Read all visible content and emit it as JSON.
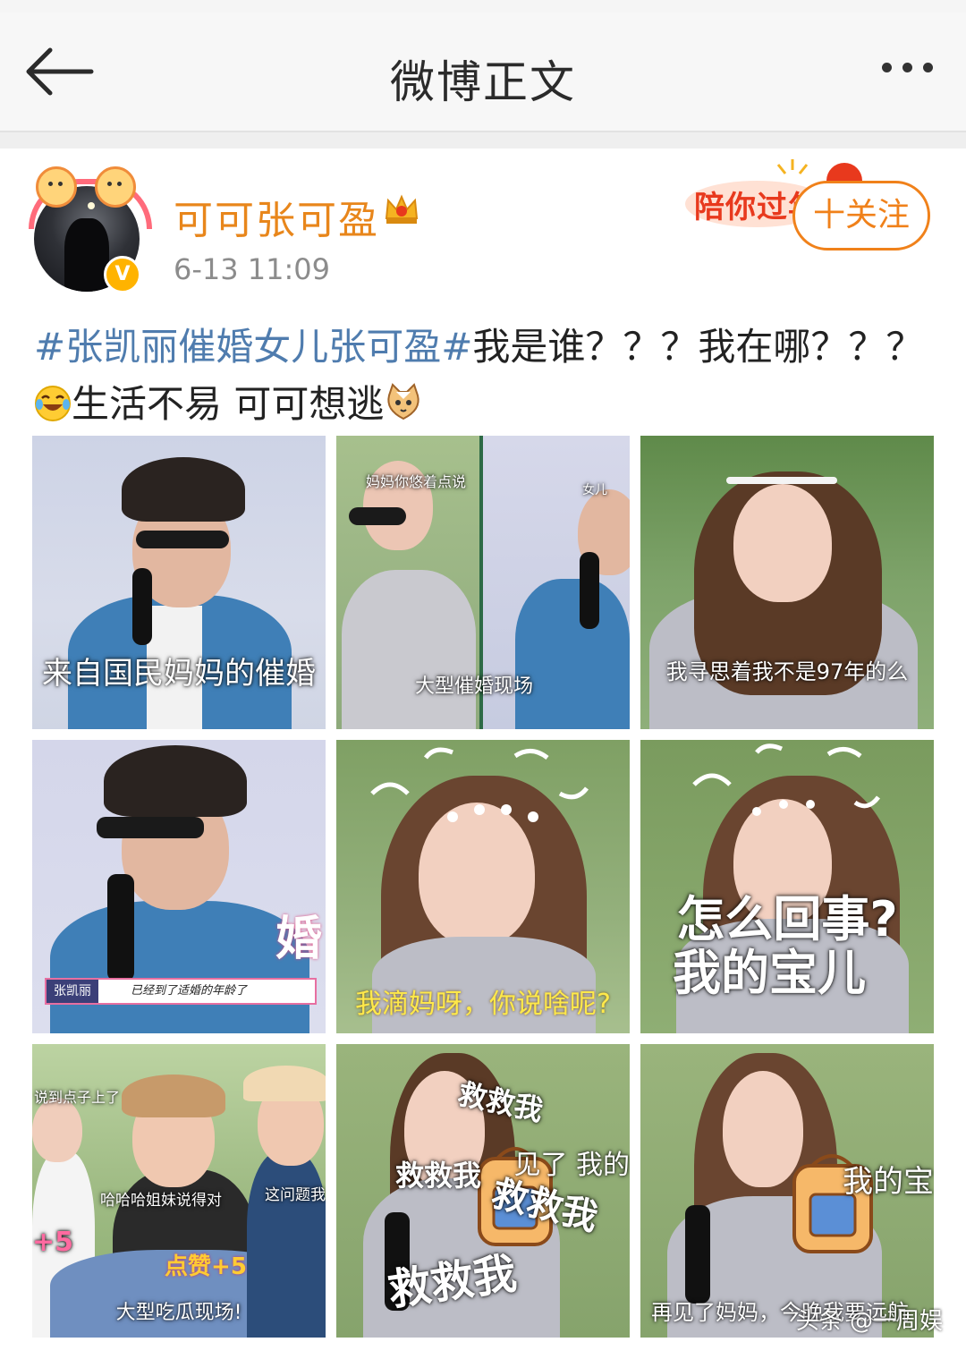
{
  "header": {
    "title": "微博正文",
    "more_label": "• • •"
  },
  "post": {
    "username": "可可张可盈",
    "time": "6-13 11:09",
    "verified_mark": "V",
    "promo_text": "陪你过年",
    "follow_label": "十关注",
    "hashtag": "#张凯丽催婚女儿张可盈#",
    "text_1": "我是谁？？？我在哪？？？",
    "text_2": "生活不易  可可想逃"
  },
  "images": [
    {
      "caption": "来自国民妈妈的催婚"
    },
    {
      "caption_top": "妈妈你悠着点说",
      "caption": "大型催婚现场",
      "side_label": "女儿"
    },
    {
      "caption": "我寻思着我不是97年的么"
    },
    {
      "name_tag": "张凯丽",
      "caption": "已经到了适婚的年龄了",
      "side_text": "婚"
    },
    {
      "caption": "我滴妈呀，你说啥呢?"
    },
    {
      "caption_line1": "怎么回事?",
      "caption_line2": "我的宝儿"
    },
    {
      "caption_top": "说到点子上了",
      "label_a": "哈哈哈姐妹说得对",
      "label_b": "这问题我",
      "label_c": "点赞+5",
      "label_d": "+5",
      "caption": "大型吃瓜现场!"
    },
    {
      "text_a": "救救我",
      "text_b": "救救我",
      "text_c": "救救我",
      "text_d": "救救我",
      "text_e": "见了 我的"
    },
    {
      "caption": "再见了妈妈，今晚我要远航",
      "side_text": "我的宝"
    }
  ],
  "source_watermark": "头条 @一周娱",
  "colors": {
    "accent": "#f0811a",
    "username": "#e8861b",
    "hashtag": "#4f7cae"
  },
  "icons": [
    "back-arrow-icon",
    "more-icon",
    "crown-icon",
    "laugh-cry-emoji",
    "cat-emoji",
    "verified-icon"
  ]
}
